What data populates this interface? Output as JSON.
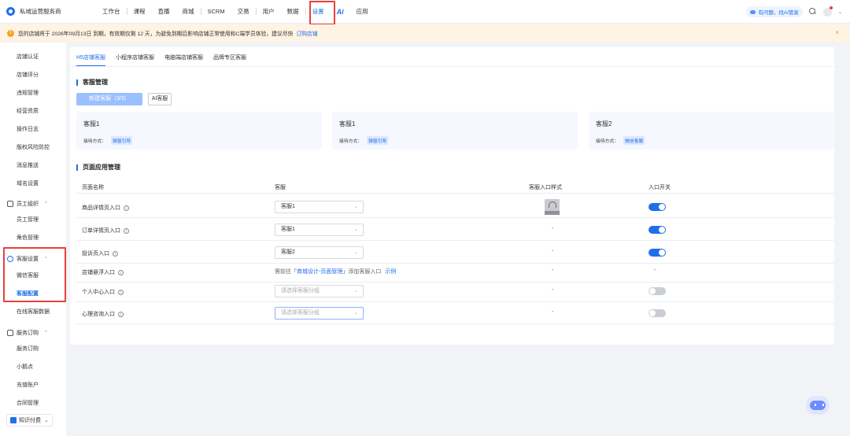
{
  "app": {
    "name": "私域运营服务商"
  },
  "nav": {
    "items": [
      "工作台",
      "课程",
      "直播",
      "商城",
      "SCRM",
      "交易",
      "用户",
      "数据",
      "设置",
      "应用"
    ],
    "ai_label": "Ai",
    "active": "设置"
  },
  "topright": {
    "ask_ai": "有问题，找AI管家"
  },
  "notice": {
    "text": "您的店铺将于 2026年09月13日 到期，有效期仅剩 12 天，为避免到期后影响店铺正常使用和C端学员体验，建议尽快",
    "link": "订购店铺",
    "close": "×"
  },
  "sidebar": {
    "items_top": [
      "店铺认证",
      "店铺评分",
      "违规管理",
      "经营资质",
      "操作日志",
      "版权风险防控",
      "消息推送",
      "域名设置"
    ],
    "group_staff": {
      "label": "员工组织",
      "items": [
        "员工管理",
        "角色管理"
      ]
    },
    "group_cs": {
      "label": "客服设置",
      "items": [
        "微信客服",
        "客服配置",
        "在线客服数据"
      ]
    },
    "group_service": {
      "label": "服务订购",
      "items": [
        "服务订购",
        "小鹅点",
        "充值账户",
        "合同管理"
      ]
    },
    "knowledge": "知识付费",
    "active_item": "客服配置"
  },
  "tabs": [
    "H5店铺客服",
    "小程序店铺客服",
    "电脑端店铺客服",
    "品牌专区客服"
  ],
  "section1": {
    "title": "客服管理"
  },
  "buttons": {
    "new": "新建客服（3/3）",
    "ai": "AI客服"
  },
  "cards": [
    {
      "name": "客服1",
      "mode_label": "接待方式：",
      "mode": "弹窗引导"
    },
    {
      "name": "客服1",
      "mode_label": "接待方式：",
      "mode": "弹窗引导"
    },
    {
      "name": "客服2",
      "mode_label": "接待方式：",
      "mode": "微信客服"
    }
  ],
  "section2": {
    "title": "页面应用管理"
  },
  "table": {
    "headers": [
      "页面名称",
      "客服",
      "客服入口样式",
      "入口开关"
    ],
    "rows": [
      {
        "name": "商品详情页入口",
        "service": "客服1",
        "style": "image",
        "switch": "on"
      },
      {
        "name": "订单详情页入口",
        "service": "客服1",
        "style": "-",
        "switch": "on"
      },
      {
        "name": "投诉页入口",
        "service": "客服2",
        "style": "-",
        "switch": "on"
      },
      {
        "name": "店铺悬浮入口",
        "service_text": "需前往「",
        "service_link": "商城设计-页面管理",
        "service_text2": "」添加客服入口",
        "service_example": "示例",
        "style": "-",
        "switch": "-"
      },
      {
        "name": "个人中心入口",
        "placeholder": "请选择客服分组",
        "style": "-",
        "switch": "off"
      },
      {
        "name": "心理咨询入口",
        "placeholder": "请选择客服分组",
        "style": "-",
        "switch": "off"
      }
    ]
  },
  "colors": {
    "accent": "#1f6feb",
    "highlight": "#e8413c",
    "notice_bg": "#fff3e3"
  }
}
